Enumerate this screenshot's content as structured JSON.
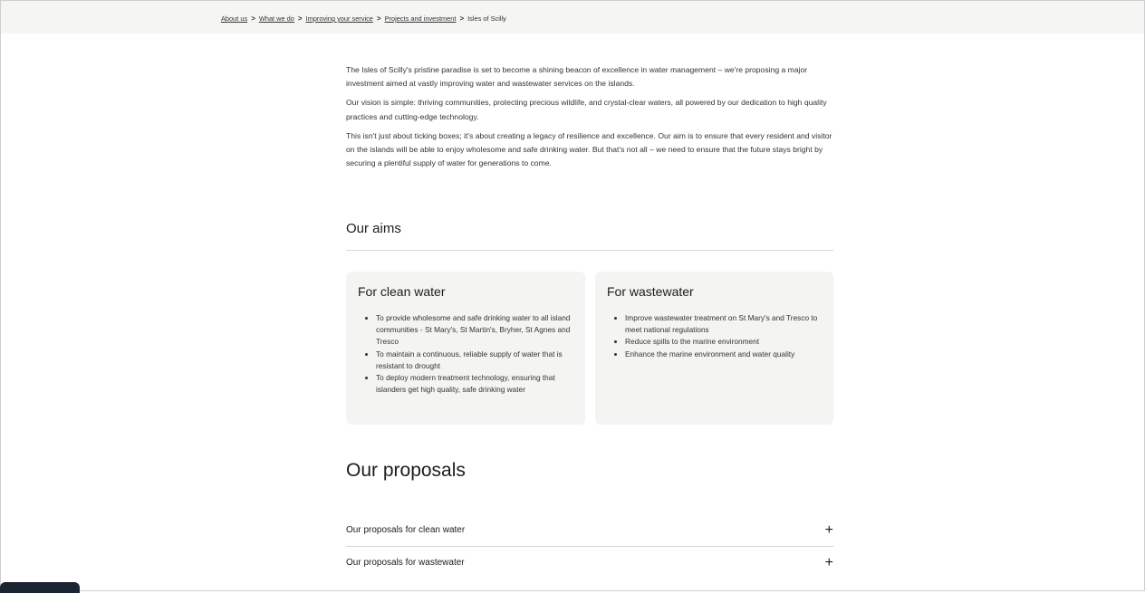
{
  "breadcrumb": {
    "items": [
      "About us",
      "What we do",
      "Improving your service",
      "Projects and investment"
    ],
    "current": "Isles of Scilly",
    "separator": ">"
  },
  "intro": {
    "p1": "The Isles of Scilly's pristine paradise is set to become a shining beacon of excellence in water management – we're proposing a major investment aimed at vastly improving water and wastewater services on the islands.",
    "p2": "Our vision is simple: thriving communities, protecting precious wildlife, and crystal-clear waters, all powered by our dedication to high quality practices and cutting-edge technology.",
    "p3": "This isn't just about ticking boxes; it's about creating a legacy of resilience and excellence. Our aim is to ensure that every resident and visitor on the islands will be able to enjoy wholesome and safe drinking water. But that's not all – we need to ensure that the future stays bright by securing a plentiful supply of water for generations to come."
  },
  "aims": {
    "title": "Our aims",
    "clean_water": {
      "title": "For clean water",
      "items": [
        "To provide wholesome and safe drinking water to all island communities - St Mary's, St Martin's, Bryher, St Agnes and Tresco",
        "To maintain a continuous, reliable supply of water that is resistant to drought",
        "To deploy modern treatment technology, ensuring that islanders get high quality, safe drinking water"
      ]
    },
    "wastewater": {
      "title": "For wastewater",
      "items": [
        "Improve wastewater treatment on St Mary's and Tresco to meet national regulations",
        "Reduce spills to the marine environment",
        "Enhance the marine environment and water quality"
      ]
    }
  },
  "proposals": {
    "title": "Our proposals",
    "accordions": [
      {
        "label": "Our proposals for clean water",
        "icon": "+"
      },
      {
        "label": "Our proposals for wastewater",
        "icon": "+"
      }
    ]
  },
  "colors": {
    "card_bg": "#f4f4f3",
    "crumb_bar_bg": "#f5f5f4",
    "chat_tab": "#1b2433"
  }
}
